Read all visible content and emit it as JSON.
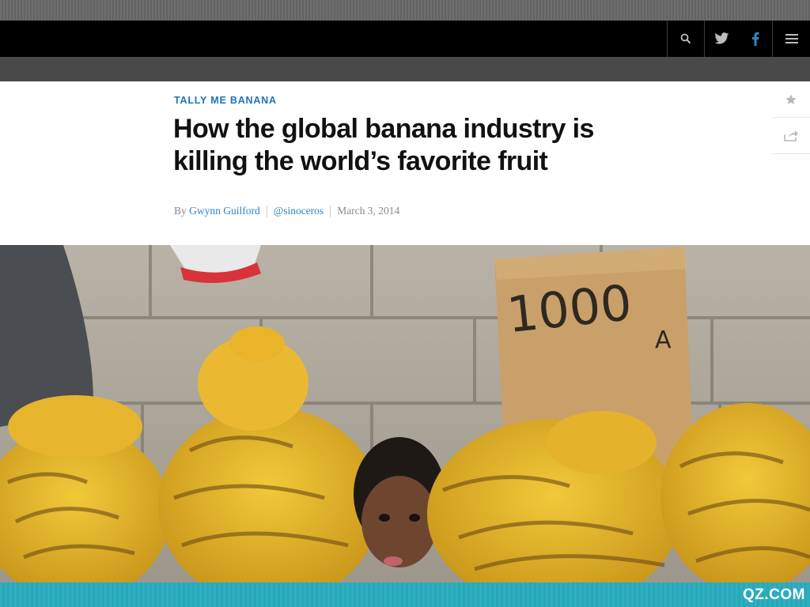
{
  "colors": {
    "accent": "#1f74b4",
    "link": "#2f86c8",
    "navbar": "#000000",
    "footer": "#2eb0c1"
  },
  "navbar": {
    "icons": [
      "search-icon",
      "twitter-icon",
      "facebook-icon",
      "menu-icon"
    ]
  },
  "article": {
    "kicker": "TALLY ME BANANA",
    "headline": "How the global banana industry is killing the world’s favorite fruit",
    "byline": {
      "prefix": "By",
      "author": "Gwynn Guilford",
      "handle": "@sinoceros",
      "date": "March 3, 2014"
    },
    "side_tools": [
      "star-icon",
      "share-icon"
    ]
  },
  "hero": {
    "sign_text": "1000",
    "sign_subtext": "A"
  },
  "footer": {
    "brand": "QZ.COM"
  }
}
